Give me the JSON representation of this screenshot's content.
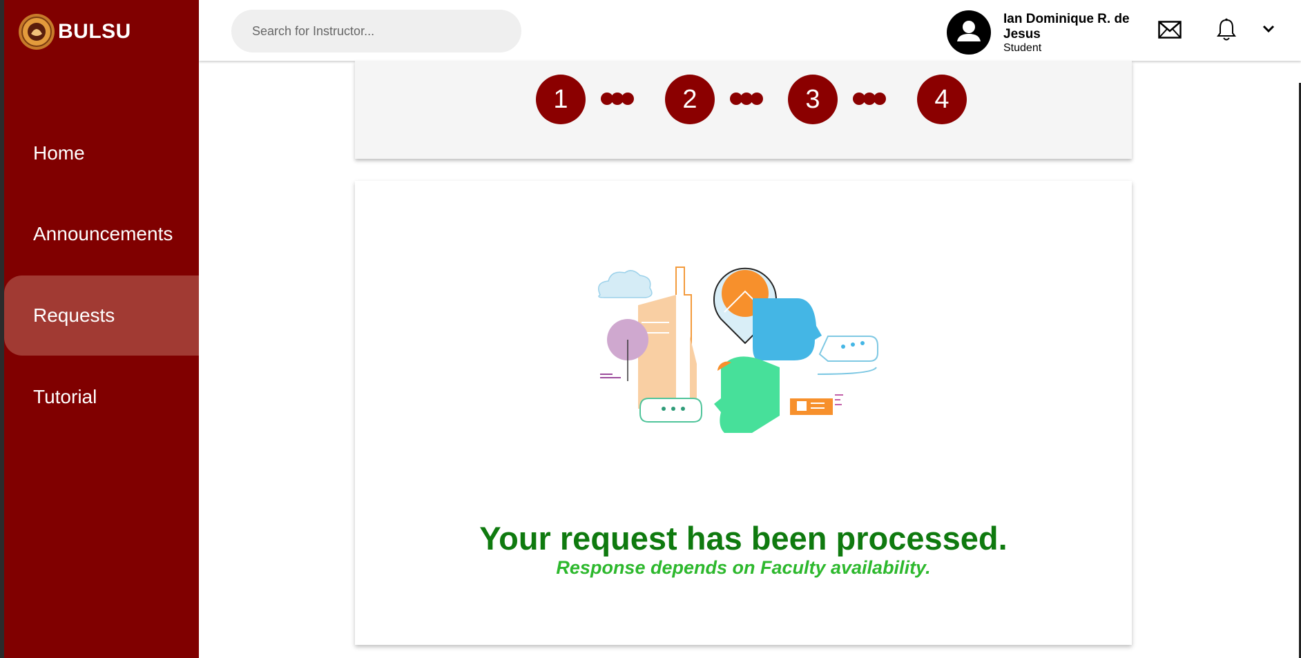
{
  "brand": {
    "name": "BULSU"
  },
  "nav": {
    "items": [
      {
        "label": "Home",
        "active": false
      },
      {
        "label": "Announcements",
        "active": false
      },
      {
        "label": "Requests",
        "active": true
      },
      {
        "label": "Tutorial",
        "active": false
      }
    ]
  },
  "header": {
    "search_placeholder": "Search for Instructor...",
    "user": {
      "name": "Ian Dominique R. de Jesus",
      "role": "Student"
    },
    "icons": [
      "mail-icon",
      "bell-icon",
      "chevron-down-icon"
    ]
  },
  "stepper": {
    "steps": [
      "1",
      "2",
      "3",
      "4"
    ]
  },
  "result": {
    "title": "Your request has been processed.",
    "subtitle": "Response depends on Faculty availability."
  },
  "colors": {
    "sidebar": "#800000",
    "active_nav": "#a13a33",
    "step": "#8b0000",
    "title_green": "#0f7a0f",
    "subtitle_green": "#2db82d"
  }
}
